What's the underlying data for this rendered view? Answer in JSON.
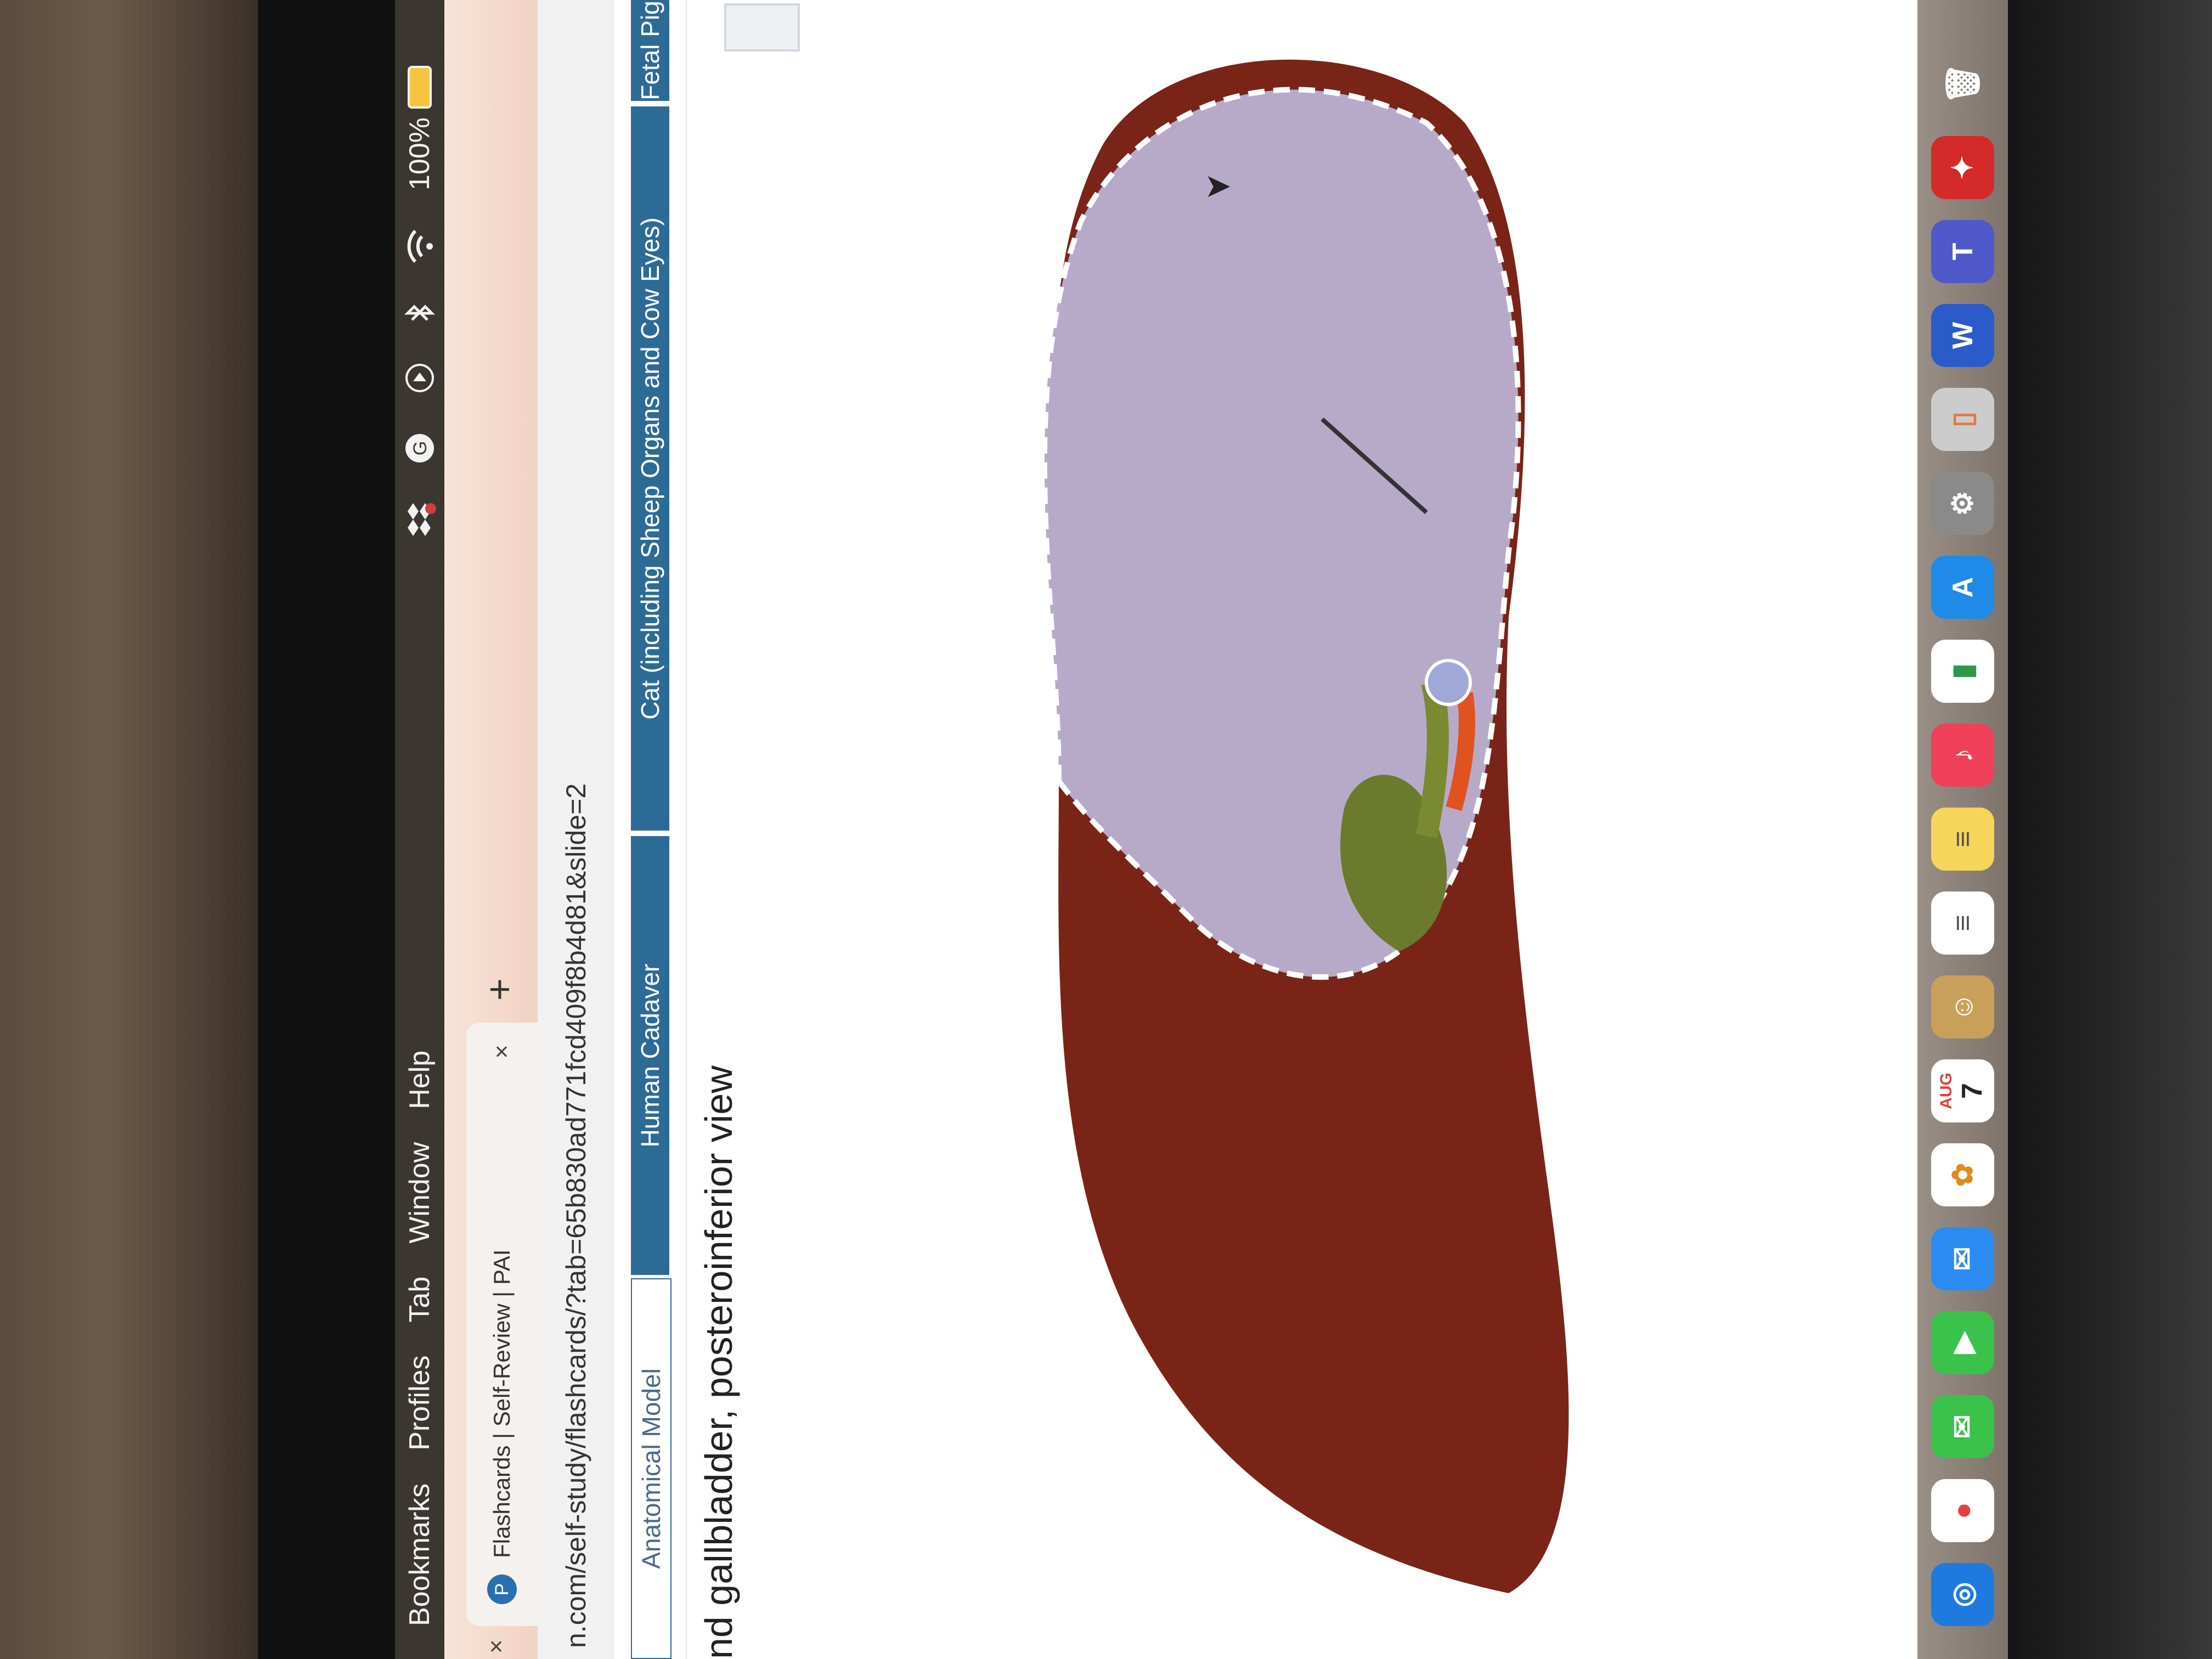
{
  "menubar": {
    "items": [
      "Bookmarks",
      "Profiles",
      "Tab",
      "Window",
      "Help"
    ],
    "battery_percent": "100%"
  },
  "tabs": [
    {
      "title": "Flashcards | Self-Review | PAI",
      "favicon": "P"
    }
  ],
  "browser": {
    "close_symbol": "×",
    "new_tab_symbol": "+",
    "url": "n.com/self-study/flashcards/?tab=65b830ad771fcd409f8b4d81&slide=2"
  },
  "site_nav": {
    "tabs": [
      {
        "label": "Anatomical Model",
        "active": false
      },
      {
        "label": "Human Cadaver",
        "active": true
      },
      {
        "label": "Cat (including Sheep Organs and Cow Eyes)",
        "active": true
      },
      {
        "label": "Fetal Pig",
        "active": true
      }
    ]
  },
  "flashcard": {
    "heading": "nd gallbladder, posteroinferior view"
  },
  "icons": {
    "cursor": "arrow-cursor-icon",
    "bluetooth": "bluetooth-icon",
    "wifi": "wifi-icon",
    "play": "play-icon",
    "grammarly": "grammarly-icon",
    "dropbox": "dropbox-icon"
  },
  "dock": {
    "apps": [
      "safari",
      "chrome",
      "messages",
      "facetime",
      "mail",
      "photos",
      "calendar",
      "contacts",
      "reminders",
      "notes",
      "music",
      "numbers",
      "app-store",
      "settings",
      "iphone-mirroring",
      "word",
      "teams",
      "acrobat",
      "trash"
    ],
    "calendar_month": "AUG",
    "calendar_day": "7"
  },
  "colors": {
    "nav_active": "#2d6b97",
    "liver": "#7a2418",
    "gallbladder": "#6b7a2c",
    "highlight_region": "#b7aac9"
  }
}
